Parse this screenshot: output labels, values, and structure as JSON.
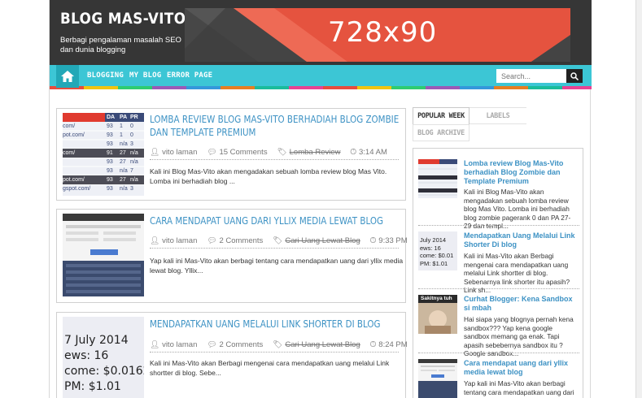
{
  "header": {
    "title": "BLOG MAS-VITO",
    "description": "Berbagi pengalaman masalah SEO dan dunia blogging",
    "banner_text": "728x90"
  },
  "nav": {
    "home_icon": "home-icon",
    "items": [
      "BLOGGING",
      "MY BLOG",
      "ERROR PAGE"
    ],
    "search_placeholder": "Search...",
    "search_icon": "search-icon"
  },
  "posts": [
    {
      "title": "LOMBA REVIEW BLOG MAS-VITO BERHADIAH BLOG ZOMBIE DAN TEMPLATE PREMIUM",
      "author": "vito laman",
      "comments": "15 Comments",
      "label": "Lomba Review",
      "time": "3:14 AM",
      "excerpt": "Kali ini Blog Mas-Vito akan mengadakan sebuah lomba review blog Mas Vito. Lomba ini berhadiah blog ..."
    },
    {
      "title": "CARA MENDAPAT UANG DARI YLLIX MEDIA LEWAT BLOG",
      "author": "vito laman",
      "comments": "2 Comments",
      "label": "Cari Uang Lewat Blog",
      "time": "9:33 PM",
      "excerpt": "Yap kali ini Mas-Vito  akan berbagi tentang cara mendapatkan uang dari yllix media lewat blog. Yllix..."
    },
    {
      "title": "MENDAPATKAN UANG MELALUI LINK SHORTER DI BLOG",
      "author": "vito laman",
      "comments": "2 Comments",
      "label": "Cari Uang Lewat Blog",
      "time": "8:24 PM",
      "excerpt": "Kali ini  Mas-Vito  akan Berbagi mengenai cara mendapatkan uang melalui Link shortter di blog. Sebe...",
      "thumb_lines": [
        "7 July 2014",
        "ews: 16",
        "come: $0.0162",
        "PM: $1.01"
      ]
    }
  ],
  "thumb1": {
    "headers": [
      "DA",
      "PA",
      "PR"
    ],
    "rows": [
      [
        "com/",
        "93",
        "1",
        "0"
      ],
      [
        "pot.com/",
        "93",
        "1",
        "0"
      ],
      [
        "",
        "93",
        "n/a",
        "3"
      ],
      [
        "com/",
        "91",
        "27",
        "n/a"
      ],
      [
        "",
        "93",
        "27",
        "n/a"
      ],
      [
        "",
        "93",
        "n/a",
        "7"
      ],
      [
        "pot.com/",
        "93",
        "27",
        "n/a"
      ],
      [
        "gspot.com/",
        "93",
        "n/a",
        "3"
      ]
    ]
  },
  "sidebar": {
    "tabs": [
      "POPULAR WEEK",
      "LABELS",
      "BLOG ARCHIVE"
    ],
    "items": [
      {
        "title": "Lomba review Blog Mas-Vito berhadiah Blog Zombie dan Template Premium",
        "excerpt": "Kali ini Blog Mas-Vito akan mengadakan sebuah lomba review blog Mas Vito. Lomba ini berhadiah blog zombie pagerank 0 dan PA 27-29 dan templ..."
      },
      {
        "title": "Mendapatkan Uang Melalui Link Shorter Di blog",
        "excerpt": "Kali ini  Mas-Vito  akan Berbagi mengenai cara mendapatkan uang melalui Link shortter di blog. Sebenarnya link shorter itu apasih?  Link sh...",
        "thumb_lines": [
          "July 2014",
          "ews: 16",
          "come: $0.01",
          "PM: $1.01"
        ]
      },
      {
        "title": "Curhat Blogger: Kena Sandbox si mbah",
        "excerpt": "Hai siapa yang blognya pernah kena sandbox???  Yap kena google sandbox memang ga enak. Tapi apasih sebebernya sandbox itu ? Google sandbox...",
        "thumb_caption": "Sakitnya tuh"
      },
      {
        "title": "Cara mendapat uang dari yllix media lewat blog",
        "excerpt": "Yap kali ini Mas-Vito  akan berbagi tentang cara mendapatkan uang dari yllix media lewat blog. Yllix"
      }
    ]
  },
  "colors": {
    "header_bg": "#363636",
    "nav_bg": "#3cc6d5",
    "link_blue": "#3d92c4",
    "banner_arrow": "#e5533f"
  }
}
